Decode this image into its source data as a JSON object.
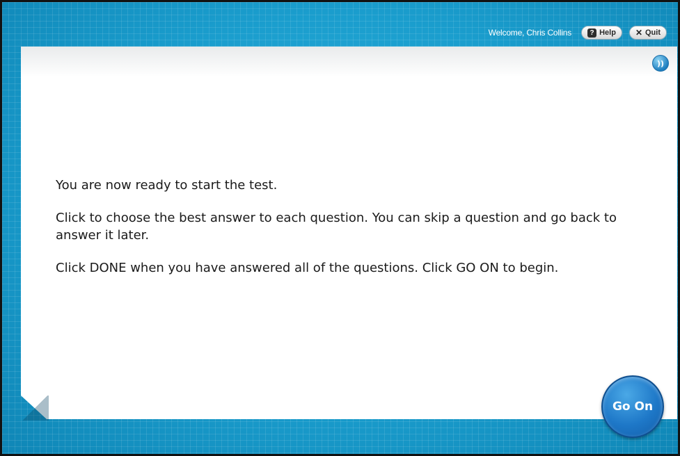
{
  "header": {
    "welcome_text": "Welcome, Chris Collins",
    "help_label": "Help",
    "help_icon": "question-icon",
    "quit_label": "Quit",
    "quit_icon": "x-icon"
  },
  "audio": {
    "icon": "speaker-audio-icon",
    "glyph": "))"
  },
  "instructions": {
    "line1": "You are now ready to start the test.",
    "line2": "Click to choose the best answer to each question. You can skip a question and go back to answer it later.",
    "line3": "Click DONE when you have answered all of the questions. Click GO ON to begin."
  },
  "footer": {
    "go_on_label": "Go On"
  },
  "colors": {
    "background": "#1597c8",
    "go_on_button": "#1e78c8",
    "panel": "#ffffff"
  }
}
